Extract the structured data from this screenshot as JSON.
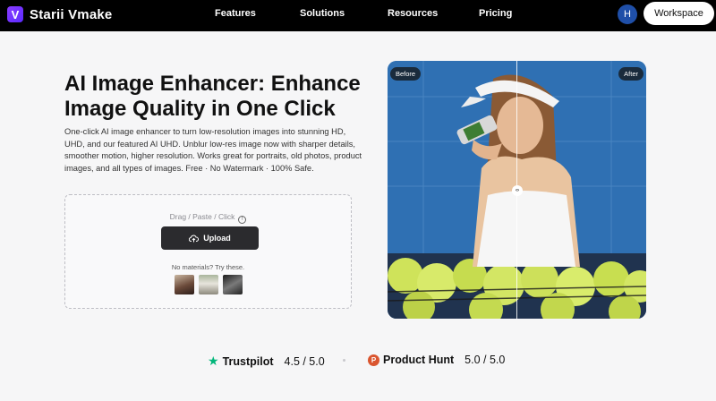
{
  "brand": {
    "name": "Starii Vmake",
    "logo_letter": "V"
  },
  "nav": {
    "links": [
      "Features",
      "Solutions",
      "Resources",
      "Pricing"
    ],
    "avatar_initial": "H",
    "workspace_label": "Workspace"
  },
  "hero": {
    "title": "AI Image Enhancer: Enhance Image Quality in One Click",
    "description": "One-click AI image enhancer to turn low-resolution images into stunning HD, UHD, and our featured AI UHD. Unblur low-res image now with sharper details, smoother motion, higher resolution. Works great for portraits, old photos, product images, and all types of images. Free · No Watermark · 100% Safe."
  },
  "upload": {
    "hint": "Drag / Paste / Click",
    "button_label": "Upload",
    "samples_label": "No materials? Try these."
  },
  "compare": {
    "before_label": "Before",
    "after_label": "After",
    "handle_glyph": "‹›"
  },
  "ratings": [
    {
      "name": "Trustpilot",
      "score": "4.5 / 5.0",
      "icon": "trustpilot-star-icon"
    },
    {
      "name": "Product Hunt",
      "score": "5.0 / 5.0",
      "icon": "product-hunt-icon",
      "icon_letter": "P"
    }
  ],
  "colors": {
    "nav_bg": "#000000",
    "upload_button": "#2b2b2e",
    "trustpilot_green": "#00b67a",
    "product_hunt_orange": "#da552f"
  }
}
